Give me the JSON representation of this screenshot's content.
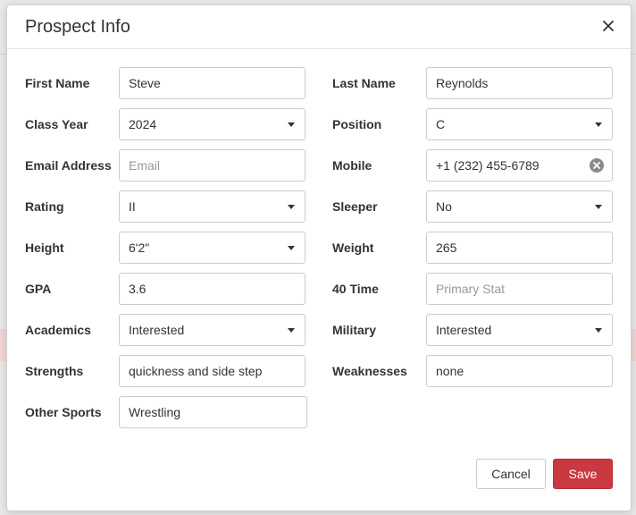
{
  "modal": {
    "title": "Prospect Info",
    "close_label": "×"
  },
  "fields": {
    "first_name": {
      "label": "First Name",
      "value": "Steve"
    },
    "last_name": {
      "label": "Last Name",
      "value": "Reynolds"
    },
    "class_year": {
      "label": "Class Year",
      "value": "2024"
    },
    "position": {
      "label": "Position",
      "value": "C"
    },
    "email": {
      "label": "Email Address",
      "value": "",
      "placeholder": "Email"
    },
    "mobile": {
      "label": "Mobile",
      "value": "+1 (232) 455-6789"
    },
    "rating": {
      "label": "Rating",
      "value": "II"
    },
    "sleeper": {
      "label": "Sleeper",
      "value": "No"
    },
    "height": {
      "label": "Height",
      "value": "6'2\""
    },
    "weight": {
      "label": "Weight",
      "value": "265"
    },
    "gpa": {
      "label": "GPA",
      "value": "3.6"
    },
    "forty_time": {
      "label": "40 Time",
      "value": "",
      "placeholder": "Primary Stat"
    },
    "academics": {
      "label": "Academics",
      "value": "Interested"
    },
    "military": {
      "label": "Military",
      "value": "Interested"
    },
    "strengths": {
      "label": "Strengths",
      "value": "quickness and side step"
    },
    "weaknesses": {
      "label": "Weaknesses",
      "value": "none"
    },
    "other_sports": {
      "label": "Other Sports",
      "value": "Wrestling"
    }
  },
  "buttons": {
    "cancel": "Cancel",
    "save": "Save"
  },
  "colors": {
    "save_button": "#c9393f",
    "backdrop_strip": "#f2d6d6"
  },
  "icons": {
    "close": "close-icon",
    "dropdown": "chevron-down-icon",
    "clear": "clear-circle-icon"
  }
}
